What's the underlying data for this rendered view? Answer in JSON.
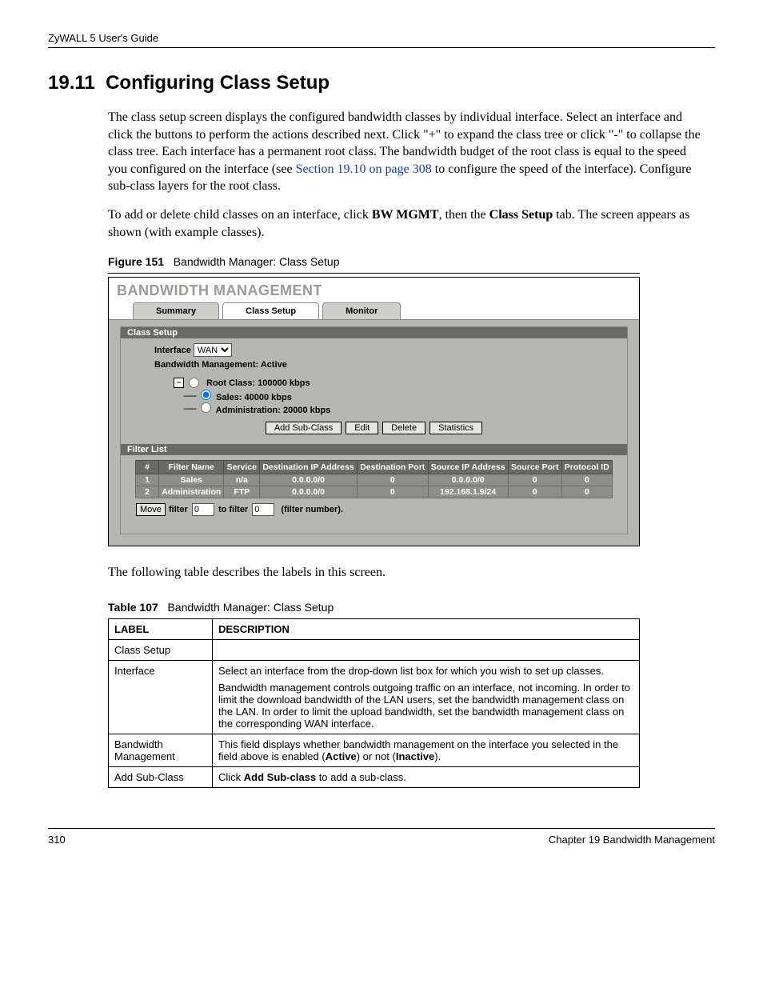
{
  "header": {
    "guide": "ZyWALL 5 User's Guide"
  },
  "section": {
    "number": "19.11",
    "title": "Configuring Class Setup"
  },
  "para1": {
    "t1": "The class setup screen displays the configured bandwidth classes by individual interface. Select an interface and click the buttons to perform the actions described next. Click \"+\" to expand the class tree or click \"-\" to collapse the class tree. Each interface has a permanent root class. The bandwidth budget of the root class is equal to the speed you configured on the interface (see ",
    "link": "Section 19.10 on page 308",
    "t2": " to configure the speed of the interface). Configure sub-class layers for the root class."
  },
  "para2": {
    "t1": "To add or delete child classes on an interface, click ",
    "b1": "BW MGMT",
    "t2": ", then the ",
    "b2": "Class Setup",
    "t3": " tab. The screen appears as shown (with example classes)."
  },
  "figure": {
    "num": "Figure 151",
    "caption": "Bandwidth Manager: Class Setup"
  },
  "ss": {
    "title": "BANDWIDTH MANAGEMENT",
    "tabs": {
      "summary": "Summary",
      "class_setup": "Class Setup",
      "monitor": "Monitor"
    },
    "group_class": "Class Setup",
    "interface_label": "Interface",
    "interface_value": "WAN",
    "bm_status": "Bandwidth Management: Active",
    "tree": {
      "root": "Root Class: 100000 kbps",
      "sales": "Sales: 40000 kbps",
      "admin": "Administration: 20000 kbps"
    },
    "buttons": {
      "add": "Add Sub-Class",
      "edit": "Edit",
      "del": "Delete",
      "stats": "Statistics"
    },
    "group_filter": "Filter List",
    "th": {
      "num": "#",
      "name": "Filter Name",
      "service": "Service",
      "dip": "Destination IP Address",
      "dport": "Destination Port",
      "sip": "Source IP Address",
      "sport": "Source Port",
      "proto": "Protocol ID"
    },
    "rows": [
      {
        "num": "1",
        "name": "Sales",
        "service": "n/a",
        "dip": "0.0.0.0/0",
        "dport": "0",
        "sip": "0.0.0.0/0",
        "sport": "0",
        "proto": "0"
      },
      {
        "num": "2",
        "name": "Administration",
        "service": "FTP",
        "dip": "0.0.0.0/0",
        "dport": "0",
        "sip": "192.168.1.9/24",
        "sport": "0",
        "proto": "0"
      }
    ],
    "move": {
      "btn": "Move",
      "t1": "filter",
      "v1": "0",
      "t2": "to filter",
      "v2": "0",
      "t3": "(filter number)."
    }
  },
  "after_fig": "The following table describes the labels in this screen.",
  "table": {
    "num": "Table 107",
    "caption": "Bandwidth Manager: Class Setup",
    "th_label": "LABEL",
    "th_desc": "DESCRIPTION",
    "rows": {
      "r0": {
        "label": "Class Setup",
        "desc": ""
      },
      "r1": {
        "label": "Interface",
        "p1": "Select an interface from the drop-down list box for which you wish to set up classes.",
        "p2": "Bandwidth management controls outgoing traffic on an interface, not incoming. In order to limit the download bandwidth of the LAN users, set the bandwidth management class on the LAN. In order to limit the upload bandwidth, set the bandwidth management class on the corresponding WAN interface."
      },
      "r2": {
        "label": "Bandwidth Management",
        "p1a": "This field displays whether bandwidth management on the interface you selected in the field above is enabled (",
        "b1": "Active",
        "p1b": ") or not (",
        "b2": "Inactive",
        "p1c": ")."
      },
      "r3": {
        "label": "Add Sub-Class",
        "p1a": "Click ",
        "b1": "Add Sub-class",
        "p1b": " to add a sub-class."
      }
    }
  },
  "footer": {
    "page": "310",
    "chapter": "Chapter 19 Bandwidth Management"
  }
}
